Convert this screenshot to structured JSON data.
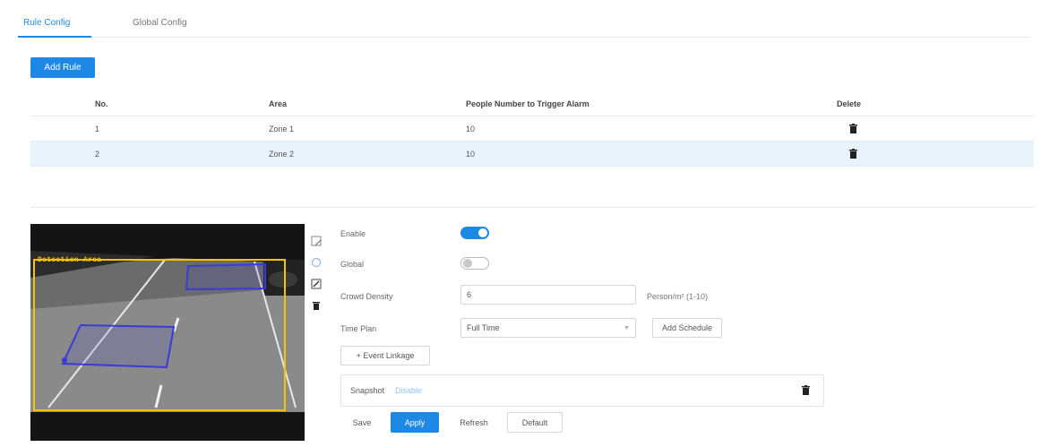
{
  "tabs": [
    {
      "label": "Rule Config",
      "active": true
    },
    {
      "label": "Global Config",
      "active": false
    }
  ],
  "add_rule_label": "Add Rule",
  "table": {
    "headers": {
      "no": "No.",
      "area": "Area",
      "people": "People Number to Trigger Alarm",
      "delete": "Delete"
    },
    "rows": [
      {
        "no": "1",
        "area": "Zone 1",
        "people": "10"
      },
      {
        "no": "2",
        "area": "Zone 2",
        "people": "10"
      }
    ],
    "selected_row": 2
  },
  "video": {
    "osd_text": "Detection Area"
  },
  "tools": [
    "draw-area-icon",
    "clear-icon",
    "draw-target-icon",
    "delete-icon"
  ],
  "form": {
    "enable": {
      "label": "Enable",
      "on": true
    },
    "global": {
      "label": "Global",
      "on": false
    },
    "crowd_density": {
      "label": "Crowd Density",
      "value": "6",
      "unit": "Person/m² (1-10)"
    },
    "time_plan": {
      "label": "Time Plan",
      "value": "Full Time",
      "add_schedule": "Add Schedule"
    },
    "event_linkage": "+ Event Linkage",
    "linkage_panel": {
      "label": "Snapshot",
      "link": "Disable"
    },
    "buttons": {
      "save": "Save",
      "apply": "Apply",
      "refresh": "Refresh",
      "default": "Default"
    }
  },
  "colors": {
    "accent": "#1e88e5",
    "selected_row": "#e8f3fc",
    "osd": "#f5c400",
    "zone": "#3a3ad8"
  }
}
